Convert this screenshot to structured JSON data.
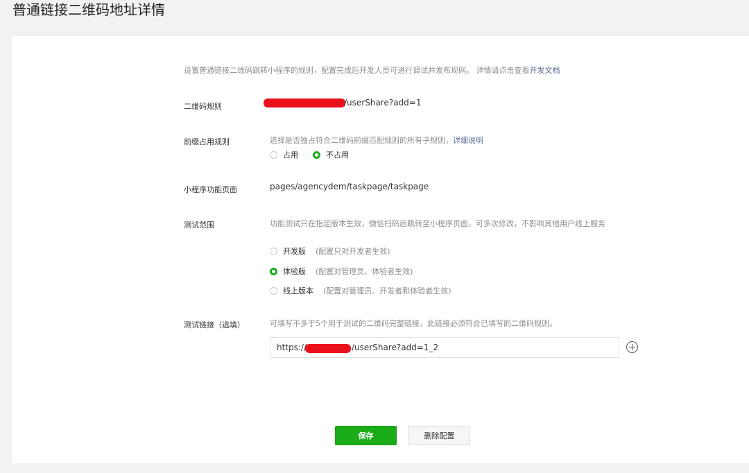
{
  "page": {
    "title": "普通链接二维码地址详情"
  },
  "intro": {
    "text": "设置普通链接二维码跳转小程序的规则，配置完成后开发人员可进行调试并发布现网。 详情请点击查看",
    "link": "开发文档"
  },
  "rule": {
    "label": "二维码规则",
    "value_suffix": "/userShare?add=1"
  },
  "prefix": {
    "label": "前缀占用规则",
    "hint": "选择是否独占符合二维码前缀匹配规则的所有子规则，",
    "hint_link": "详细说明",
    "options": [
      {
        "label": "占用",
        "checked": false
      },
      {
        "label": "不占用",
        "checked": true
      }
    ]
  },
  "page_path": {
    "label": "小程序功能页面",
    "value": "pages/agencydem/taskpage/taskpage"
  },
  "test_scope": {
    "label": "测试范围",
    "hint": "功能测试只在指定版本生效，微信扫码后跳转至小程序页面，可多次修改，不影响其他用户线上服务",
    "options": [
      {
        "label": "开发版",
        "note": "(配置只对开发者生效)",
        "checked": false
      },
      {
        "label": "体验版",
        "note": "(配置对管理员、体验者生效)",
        "checked": true
      },
      {
        "label": "线上版本",
        "note": "(配置对管理员、开发者和体验者生效)",
        "checked": false
      }
    ]
  },
  "test_link": {
    "label": "测试链接（选填）",
    "hint": "可填写不多于5个用于测试的二维码完整链接，此链接必须符合已填写的二维码规则。",
    "value_prefix": "https://",
    "value_suffix": "/userShare?add=1_2"
  },
  "buttons": {
    "save": "保存",
    "delete": "删除配置"
  },
  "colors": {
    "accent": "#1aad19",
    "link": "#576b95",
    "redaction": "#e9101c"
  }
}
